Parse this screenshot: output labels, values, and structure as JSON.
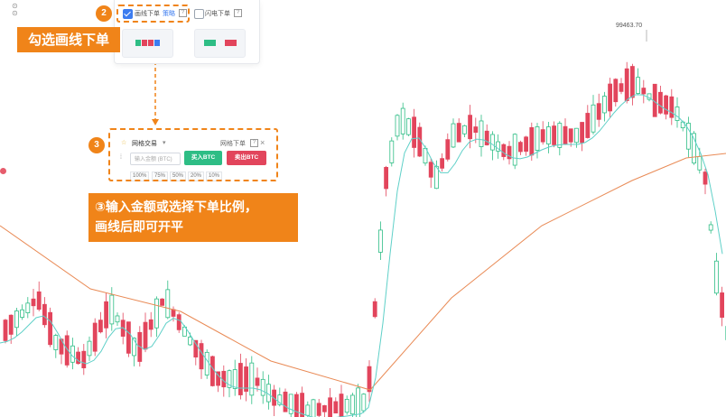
{
  "colors": {
    "accent_orange": "#f08419",
    "candle_up": "#2ebd85",
    "candle_down": "#e2455c",
    "ma_fast": "#5fd0c8",
    "ma_slow": "#e98a55",
    "button_blue_check": "#3c7cf0"
  },
  "top_panel": {
    "step_number": "2",
    "option_line_order": "画线下单",
    "option_line_order_tag": "策略",
    "option_flash_order": "闪电下单",
    "help_mark": "?"
  },
  "callout_step2": "勾选画线下单",
  "trade_panel": {
    "step_number": "3",
    "title": "网格交易",
    "right_label": "网格下单",
    "help_mark": "?",
    "close_icon": "×",
    "amount_placeholder": "输入金额 (BTC)",
    "buy_button": "买入BTC",
    "sell_button": "卖出BTC",
    "ratios": [
      "100%",
      "75%",
      "50%",
      "20%",
      "10%"
    ]
  },
  "callout_step3_line1": "③输入金额或选择下单比例，",
  "callout_step3_line2": "画线后即可开平",
  "price_marker": "99463.70",
  "chart_data": {
    "type": "candlestick",
    "title": "",
    "xlabel": "",
    "ylabel": "",
    "series": [
      {
        "values": []
      },
      {
        "values": []
      }
    ],
    "annotations": [
      "99463.70"
    ],
    "visible_high": 99463.7,
    "grid": false
  }
}
